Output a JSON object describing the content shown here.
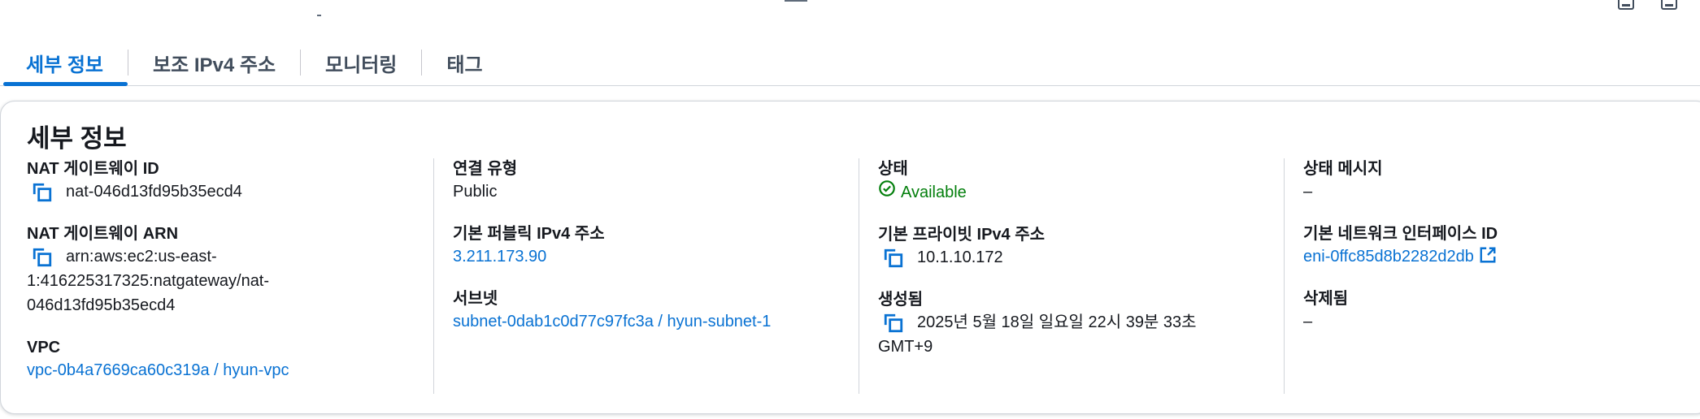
{
  "tabs": [
    {
      "label": "세부 정보",
      "active": true
    },
    {
      "label": "보조 IPv4 주소",
      "active": false
    },
    {
      "label": "모니터링",
      "active": false
    },
    {
      "label": "태그",
      "active": false
    }
  ],
  "panel": {
    "title": "세부 정보",
    "col1": {
      "nat_id_label": "NAT 게이트웨이 ID",
      "nat_id_value": "nat-046d13fd95b35ecd4",
      "nat_arn_label": "NAT 게이트웨이 ARN",
      "nat_arn_line1": "arn:aws:ec2:us-east-",
      "nat_arn_line2": "1:416225317325:natgateway/nat-",
      "nat_arn_line3": "046d13fd95b35ecd4",
      "vpc_label": "VPC",
      "vpc_value": "vpc-0b4a7669ca60c319a / hyun-vpc"
    },
    "col2": {
      "conn_type_label": "연결 유형",
      "conn_type_value": "Public",
      "public_ip_label": "기본 퍼블릭 IPv4 주소",
      "public_ip_value": "3.211.173.90",
      "subnet_label": "서브넷",
      "subnet_value": "subnet-0dab1c0d77c97fc3a / hyun-subnet-1"
    },
    "col3": {
      "state_label": "상태",
      "state_value": "Available",
      "private_ip_label": "기본 프라이빗 IPv4 주소",
      "private_ip_value": "10.1.10.172",
      "created_label": "생성됨",
      "created_line1": "2025년 5월 18일 일요일 22시 39분 33초",
      "created_line2": "GMT+9"
    },
    "col4": {
      "state_msg_label": "상태 메시지",
      "state_msg_value": "–",
      "eni_label": "기본 네트워크 인터페이스 ID",
      "eni_value": "eni-0ffc85d8b2282d2db",
      "deleted_label": "삭제됨",
      "deleted_value": "–"
    }
  },
  "colors": {
    "accent": "#0972d3",
    "success": "#037f0c",
    "text": "#16191f",
    "tab_inactive": "#414d5c"
  },
  "icons": {
    "copy": "copy-icon",
    "status": "check-circle-icon",
    "external": "external-link-icon"
  }
}
